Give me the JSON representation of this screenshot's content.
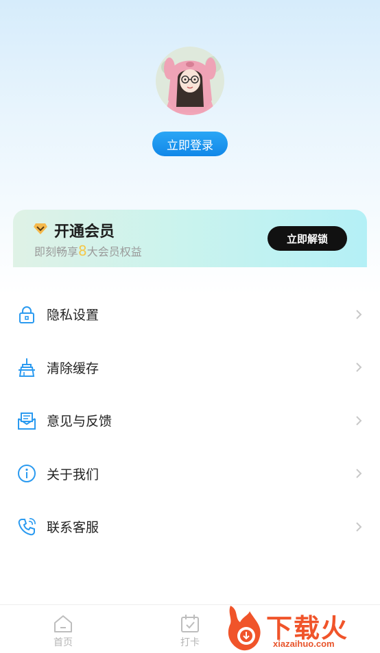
{
  "profile": {
    "login_label": "立即登录"
  },
  "vip": {
    "title": "开通会员",
    "subtitle_prefix": "即刻畅享",
    "subtitle_num": "8",
    "subtitle_suffix": "大会员权益",
    "unlock_label": "立即解锁",
    "accent_color": "#f4c74a"
  },
  "menu": {
    "items": [
      {
        "label": "隐私设置",
        "icon": "lock-icon"
      },
      {
        "label": "清除缓存",
        "icon": "broom-icon"
      },
      {
        "label": "意见与反馈",
        "icon": "feedback-mail-icon"
      },
      {
        "label": "关于我们",
        "icon": "info-icon"
      },
      {
        "label": "联系客服",
        "icon": "phone-icon"
      }
    ]
  },
  "tabbar": {
    "tabs": [
      {
        "label": "首页",
        "icon": "home-icon"
      },
      {
        "label": "打卡",
        "icon": "calendar-checkin-icon"
      }
    ]
  },
  "watermark": {
    "text": "下载火",
    "url": "xiazaihuo.com"
  },
  "colors": {
    "primary": "#1a93ee",
    "icon_blue": "#2a9af0",
    "brand_orange": "#f0542a"
  }
}
